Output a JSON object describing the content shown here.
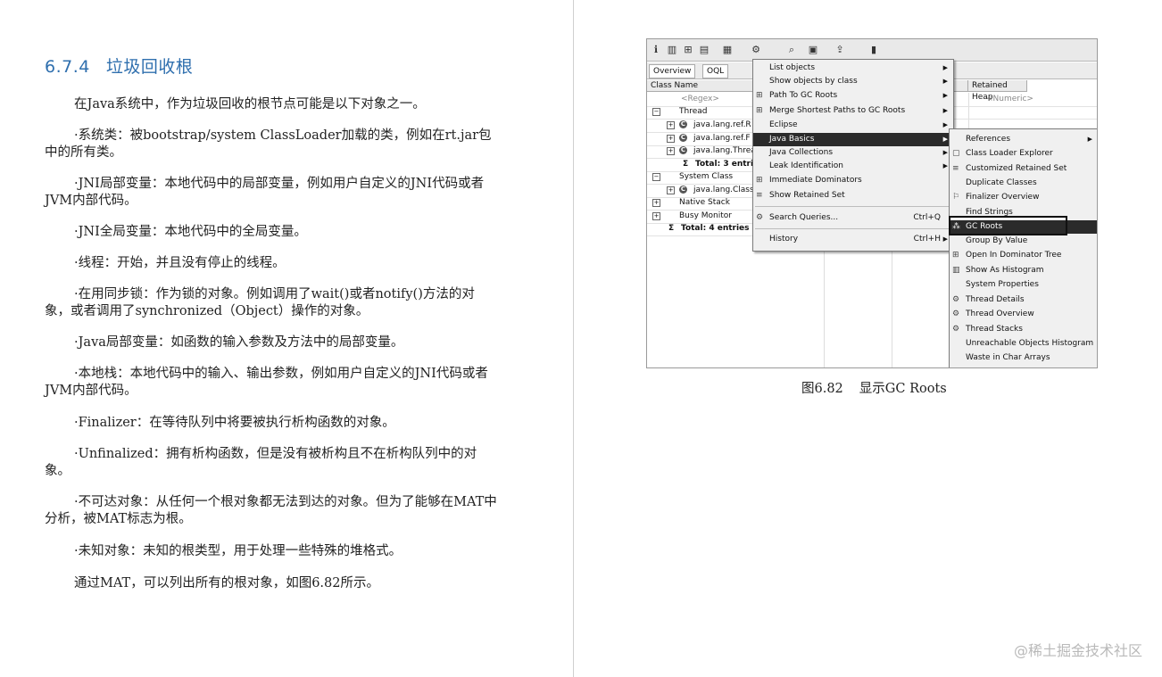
{
  "section": {
    "number": "6.7.4",
    "title": "垃圾回收根"
  },
  "paragraphs": [
    "在Java系统中，作为垃圾回收的根节点可能是以下对象之一。",
    "·系统类：被bootstrap/system ClassLoader加载的类，例如在rt.jar包中的所有类。",
    "·JNI局部变量：本地代码中的局部变量，例如用户自定义的JNI代码或者JVM内部代码。",
    "·JNI全局变量：本地代码中的全局变量。",
    "·线程：开始，并且没有停止的线程。",
    "·在用同步锁：作为锁的对象。例如调用了wait()或者notify()方法的对象，或者调用了synchronized（Object）操作的对象。",
    "·Java局部变量：如函数的输入参数及方法中的局部变量。",
    "·本地栈：本地代码中的输入、输出参数，例如用户自定义的JNI代码或者JVM内部代码。",
    "·Finalizer：在等待队列中将要被执行析构函数的对象。",
    "·Unfinalized：拥有析构函数，但是没有被析构且不在析构队列中的对象。",
    "·不可达对象：从任何一个根对象都无法到达的对象。但为了能够在MAT中分析，被MAT标志为根。",
    "·未知对象：未知的根类型，用于处理一些特殊的堆格式。",
    "通过MAT，可以列出所有的根对象，如图6.82所示。"
  ],
  "figure": {
    "tabs": [
      "Overview",
      "OQL"
    ],
    "columns": {
      "class_name": "Class Name",
      "retained_heap": "Retained Heap"
    },
    "regex_placeholder": "<Regex>",
    "numeric_placeholder": "<Numeric>",
    "rows": [
      {
        "label": "Thread"
      },
      {
        "label": "java.lang.ref.R"
      },
      {
        "label": "java.lang.ref.F"
      },
      {
        "label": "java.lang.Threa"
      },
      {
        "label": "Total: 3 entri"
      },
      {
        "label": "System Class"
      },
      {
        "label": "java.lang.Class"
      },
      {
        "label": "Native Stack"
      },
      {
        "label": "Busy Monitor"
      },
      {
        "label": "Total: 4 entries"
      }
    ],
    "menu": [
      {
        "label": "List objects",
        "submenu": true
      },
      {
        "label": "Show objects by class",
        "submenu": true
      },
      {
        "label": "Path To GC Roots",
        "submenu": true
      },
      {
        "label": "Merge Shortest Paths to GC Roots",
        "submenu": true
      },
      {
        "label": "Eclipse",
        "submenu": true
      },
      {
        "label": "Java Basics",
        "submenu": true,
        "selected": true
      },
      {
        "label": "Java Collections",
        "submenu": true
      },
      {
        "label": "Leak Identification",
        "submenu": true
      },
      {
        "label": "Immediate Dominators"
      },
      {
        "label": "Show Retained Set"
      },
      {
        "label": "Search Queries...",
        "shortcut": "Ctrl+Q"
      },
      {
        "label": "History",
        "shortcut": "Ctrl+H",
        "submenu": true
      }
    ],
    "submenu": [
      {
        "label": "References",
        "submenu": true
      },
      {
        "label": "Class Loader Explorer"
      },
      {
        "label": "Customized Retained Set"
      },
      {
        "label": "Duplicate Classes"
      },
      {
        "label": "Finalizer Overview"
      },
      {
        "label": "Find Strings"
      },
      {
        "label": "GC Roots",
        "selected": true
      },
      {
        "label": "Group By Value"
      },
      {
        "label": "Open In Dominator Tree"
      },
      {
        "label": "Show As Histogram"
      },
      {
        "label": "System Properties"
      },
      {
        "label": "Thread Details"
      },
      {
        "label": "Thread Overview"
      },
      {
        "label": "Thread Stacks"
      },
      {
        "label": "Unreachable Objects Histogram"
      },
      {
        "label": "Waste in Char Arrays"
      }
    ]
  },
  "caption": {
    "number": "图6.82",
    "text": "显示GC Roots"
  },
  "watermark": "@稀土掘金技术社区",
  "colors": {
    "heading": "#2f6fae",
    "menu_selected": "#2b2b2b"
  }
}
